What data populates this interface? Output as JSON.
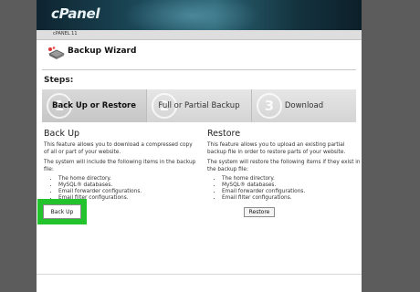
{
  "banner": {
    "logo": "cPanel"
  },
  "subbar": {
    "user": "cPANEL 11"
  },
  "page": {
    "title": "Backup Wizard"
  },
  "steps": {
    "label": "Steps:",
    "items": [
      {
        "number": "1",
        "label": "Back Up or Restore",
        "active": true
      },
      {
        "number": "2",
        "label": "Full or Partial Backup",
        "active": false
      },
      {
        "number": "3",
        "label": "Download",
        "active": false
      }
    ]
  },
  "backup": {
    "heading": "Back Up",
    "description": "This feature allows you to download a compressed copy of all or part of your website.",
    "intro": "The system will include the following items in the backup file:",
    "items": [
      "The home directory.",
      "MySQL® databases.",
      "Email forwarder configurations.",
      "Email filter configurations."
    ],
    "button": "Back Up"
  },
  "restore": {
    "heading": "Restore",
    "description": "This feature allows you to upload an existing partial backup file in order to restore parts of your website.",
    "intro": "The system will restore the following items if they exist in the backup file:",
    "items": [
      "The home directory.",
      "MySQL® databases.",
      "Email forwarder configurations.",
      "Email filter configurations."
    ],
    "button": "Restore"
  },
  "colors": {
    "highlight": "#22c32c",
    "banner": "#1d4c5c",
    "background": "#5c5c5c"
  },
  "icons": [
    "cpanel-logo",
    "backup-wizard-icon"
  ]
}
